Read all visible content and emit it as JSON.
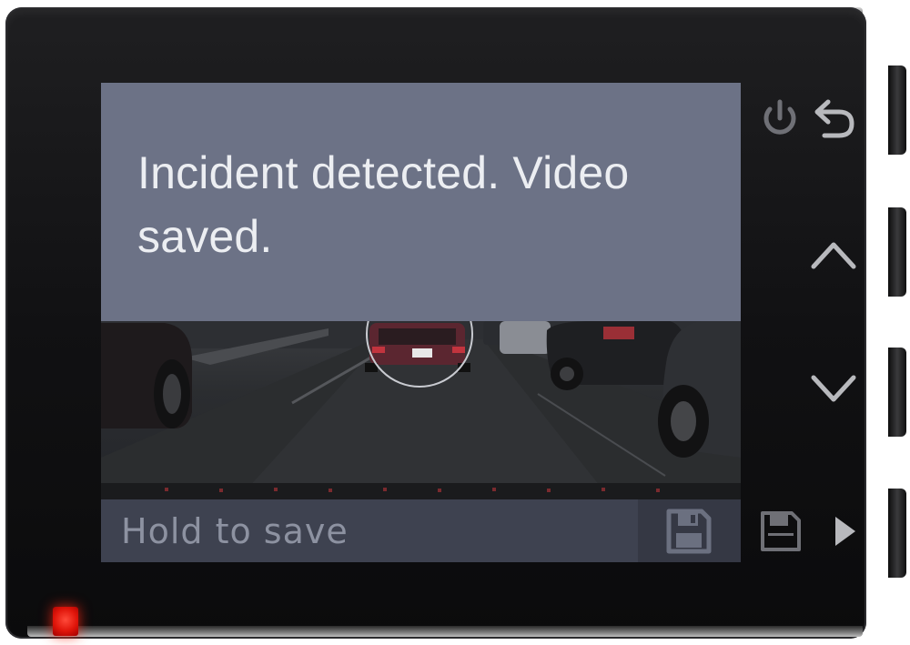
{
  "notification": {
    "message": "Incident detected. Video saved."
  },
  "bottom_bar": {
    "hint": "Hold to save",
    "action_icon": "save-icon"
  },
  "hardware_buttons": [
    {
      "icon": "power-icon"
    },
    {
      "icon": "back-icon"
    },
    {
      "icon": "chevron-up-icon"
    },
    {
      "icon": "chevron-down-icon"
    },
    {
      "icon": "save-icon"
    },
    {
      "icon": "play-icon"
    }
  ],
  "colors": {
    "notice_background": "#6c7286",
    "notice_text": "#eceef2",
    "bottom_bar_background": "#3e4250",
    "hint_text": "#8d92a1",
    "status_led": "#e0150a"
  }
}
